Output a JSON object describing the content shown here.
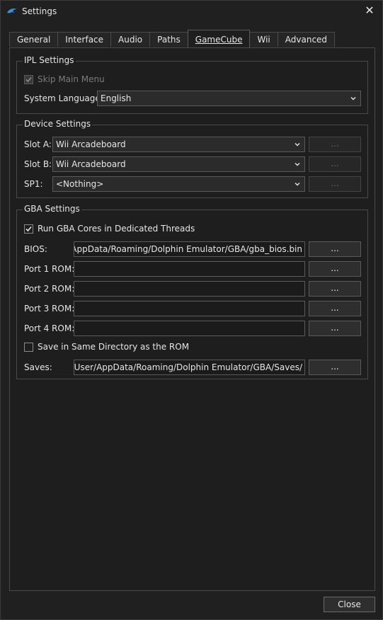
{
  "window": {
    "title": "Settings",
    "icon": "dolphin-icon",
    "close_glyph": "✕"
  },
  "tabs": [
    {
      "label": "General"
    },
    {
      "label": "Interface"
    },
    {
      "label": "Audio"
    },
    {
      "label": "Paths"
    },
    {
      "label": "GameCube",
      "active": true
    },
    {
      "label": "Wii"
    },
    {
      "label": "Advanced"
    }
  ],
  "ipl": {
    "legend": "IPL Settings",
    "skip_main_menu": {
      "label": "Skip Main Menu",
      "checked": true,
      "enabled": false
    },
    "system_language": {
      "label": "System Language:",
      "value": "English"
    }
  },
  "device": {
    "legend": "Device Settings",
    "slot_a": {
      "label": "Slot A:",
      "value": "Wii Arcadeboard",
      "button": "..."
    },
    "slot_b": {
      "label": "Slot B:",
      "value": "Wii Arcadeboard",
      "button": "..."
    },
    "sp1": {
      "label": "SP1:",
      "value": "<Nothing>",
      "button": "..."
    }
  },
  "gba": {
    "legend": "GBA Settings",
    "dedicated_threads": {
      "label": "Run GBA Cores in Dedicated Threads",
      "checked": true
    },
    "bios": {
      "label": "BIOS:",
      "value": "Jser/AppData/Roaming/Dolphin Emulator/GBA/gba_bios.bin",
      "button": "..."
    },
    "port1": {
      "label": "Port 1 ROM:",
      "value": "",
      "button": "..."
    },
    "port2": {
      "label": "Port 2 ROM:",
      "value": "",
      "button": "..."
    },
    "port3": {
      "label": "Port 3 ROM:",
      "value": "",
      "button": "..."
    },
    "port4": {
      "label": "Port 4 ROM:",
      "value": "",
      "button": "..."
    },
    "save_same_dir": {
      "label": "Save in Same Directory as the ROM",
      "checked": false
    },
    "saves": {
      "label": "Saves:",
      "value": "Jsers/User/AppData/Roaming/Dolphin Emulator/GBA/Saves/",
      "button": "..."
    }
  },
  "footer": {
    "close_label": "Close"
  },
  "colors": {
    "background": "#1e1e1e",
    "border": "#4a4a4a",
    "text": "#e6e6e6",
    "accent": "#3a8fd6"
  }
}
